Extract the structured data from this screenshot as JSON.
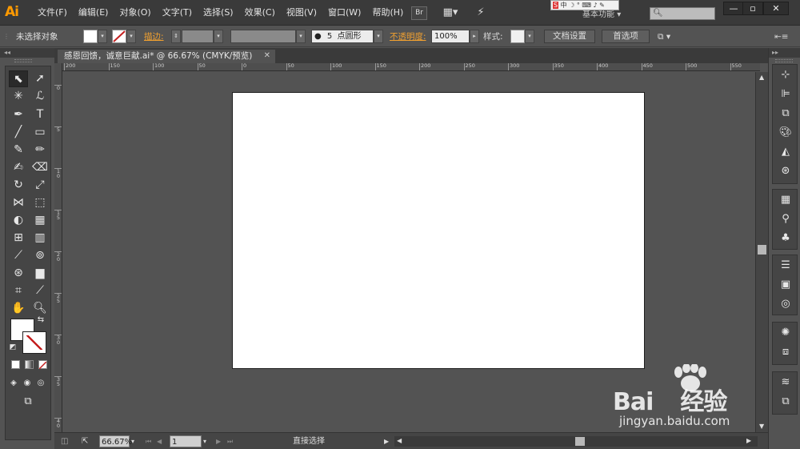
{
  "app": {
    "logo": "Ai"
  },
  "menu": [
    "文件(F)",
    "编辑(E)",
    "对象(O)",
    "文字(T)",
    "选择(S)",
    "效果(C)",
    "视图(V)",
    "窗口(W)",
    "帮助(H)"
  ],
  "menubar": {
    "bridge_label": "Br",
    "workspace_label": "基本功能",
    "ime_text": "中 ☽ ° ⌨ ♪ ✎"
  },
  "controlbar": {
    "selection_status": "未选择对象",
    "stroke_label": "描边:",
    "brush_size": "5",
    "brush_shape": "点圆形",
    "opacity_label": "不透明度:",
    "opacity_value": "100%",
    "style_label": "样式:",
    "doc_setup_button": "文档设置",
    "preferences_button": "首选项"
  },
  "document": {
    "tab_title": "感恩回馈，诚意巨献.ai* @ 66.67% (CMYK/预览)",
    "ruler_h_labels": [
      "200",
      "150",
      "100",
      "50",
      "0",
      "50",
      "100",
      "150",
      "200",
      "250",
      "300",
      "350",
      "400",
      "450",
      "500",
      "550"
    ],
    "ruler_v_labels": [
      "0",
      "5",
      "1 0",
      "1 5",
      "2 0",
      "2 5",
      "3 0",
      "3 5",
      "4 0"
    ]
  },
  "statusbar": {
    "zoom_value": "66.67%",
    "page_value": "1",
    "current_tool": "直接选择"
  },
  "watermark": {
    "brand": "Bai",
    "brand_suffix": "经验",
    "url": "jingyan.baidu.com"
  }
}
